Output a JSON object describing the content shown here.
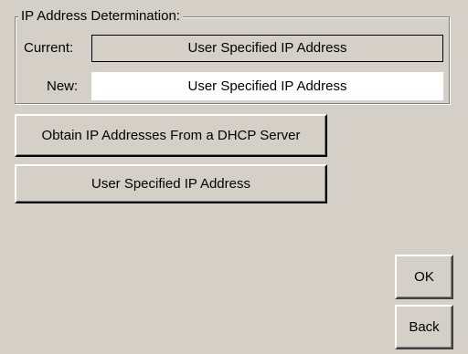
{
  "ip_group": {
    "title": "IP Address Determination:",
    "current_label": "Current:",
    "current_value": "User Specified IP Address",
    "new_label": "New:",
    "new_value": "User Specified IP Address"
  },
  "options": {
    "dhcp_label": "Obtain IP Addresses From a DHCP Server",
    "user_specified_label": "User Specified IP Address"
  },
  "actions": {
    "ok_label": "OK",
    "back_label": "Back"
  }
}
